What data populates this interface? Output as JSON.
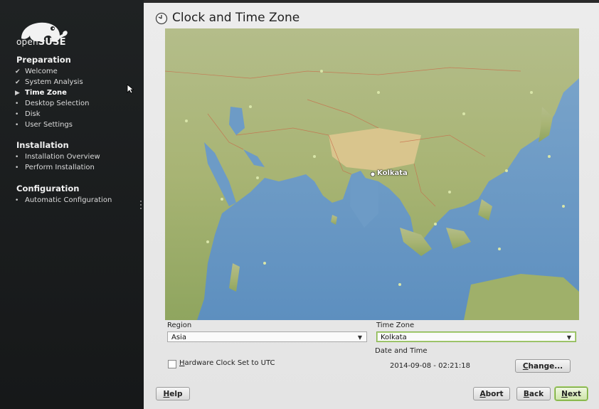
{
  "brand": {
    "prefix": "open",
    "name": "SUSE"
  },
  "sidebar": {
    "sections": [
      {
        "title": "Preparation",
        "items": [
          {
            "label": "Welcome",
            "marker": "check"
          },
          {
            "label": "System Analysis",
            "marker": "check"
          },
          {
            "label": "Time Zone",
            "marker": "current"
          },
          {
            "label": "Desktop Selection",
            "marker": "bullet"
          },
          {
            "label": "Disk",
            "marker": "bullet"
          },
          {
            "label": "User Settings",
            "marker": "bullet"
          }
        ]
      },
      {
        "title": "Installation",
        "items": [
          {
            "label": "Installation Overview",
            "marker": "bullet"
          },
          {
            "label": "Perform Installation",
            "marker": "bullet"
          }
        ]
      },
      {
        "title": "Configuration",
        "items": [
          {
            "label": "Automatic Configuration",
            "marker": "bullet"
          }
        ]
      }
    ]
  },
  "page": {
    "title": "Clock and Time Zone"
  },
  "map": {
    "selected_city": "Kolkata"
  },
  "region": {
    "label": "Region",
    "value": "Asia"
  },
  "timezone": {
    "label": "Time Zone",
    "value": "Kolkata"
  },
  "datetime": {
    "label": "Date and Time",
    "value": "2014-09-08 - 02:21:18"
  },
  "hwclock": {
    "label": "Hardware Clock Set to UTC",
    "checked": false
  },
  "buttons": {
    "change": "Change...",
    "help": "Help",
    "abort": "Abort",
    "back": "Back",
    "next": "Next"
  },
  "colors": {
    "accent": "#86b34b",
    "sidebar_bg": "#1c1e1f",
    "ocean": "#6f9cc4",
    "land": "#a9b77a"
  }
}
